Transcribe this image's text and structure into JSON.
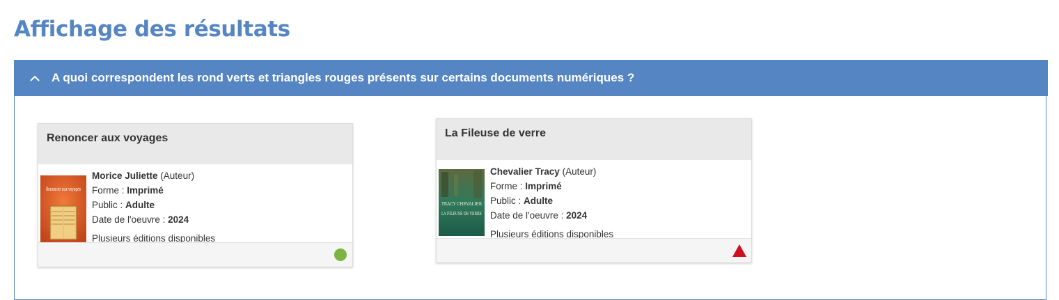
{
  "page": {
    "title": "Affichage des résultats"
  },
  "accordion": {
    "title": "A quoi correspondent les rond verts et triangles rouges présents sur certains documents numériques ?",
    "expanded": true,
    "header_color": "#5585c3"
  },
  "cards": [
    {
      "title": "Renoncer aux voyages",
      "author": "Morice Juliette",
      "author_role": "(Auteur)",
      "form_label": "Forme : ",
      "form_value": "Imprimé",
      "public_label": "Public : ",
      "public_value": "Adulte",
      "date_label": "Date de l'oeuvre : ",
      "date_value": "2024",
      "editions": "Plusieurs éditions disponibles",
      "cover_title": "Renoncer aux voyages",
      "status_icon": "green-circle",
      "status_color": "#7cb342"
    },
    {
      "title": "La Fileuse de verre",
      "author": "Chevalier Tracy",
      "author_role": "(Auteur)",
      "form_label": "Forme : ",
      "form_value": "Imprimé",
      "public_label": "Public : ",
      "public_value": "Adulte",
      "date_label": "Date de l'oeuvre : ",
      "date_value": "2024",
      "editions": "Plusieurs éditions disponibles",
      "cover_author": "TRACY CHEVALIER",
      "cover_title": "LA FILEUSE DE VERRE",
      "status_icon": "red-triangle",
      "status_color": "#cc1122"
    }
  ]
}
